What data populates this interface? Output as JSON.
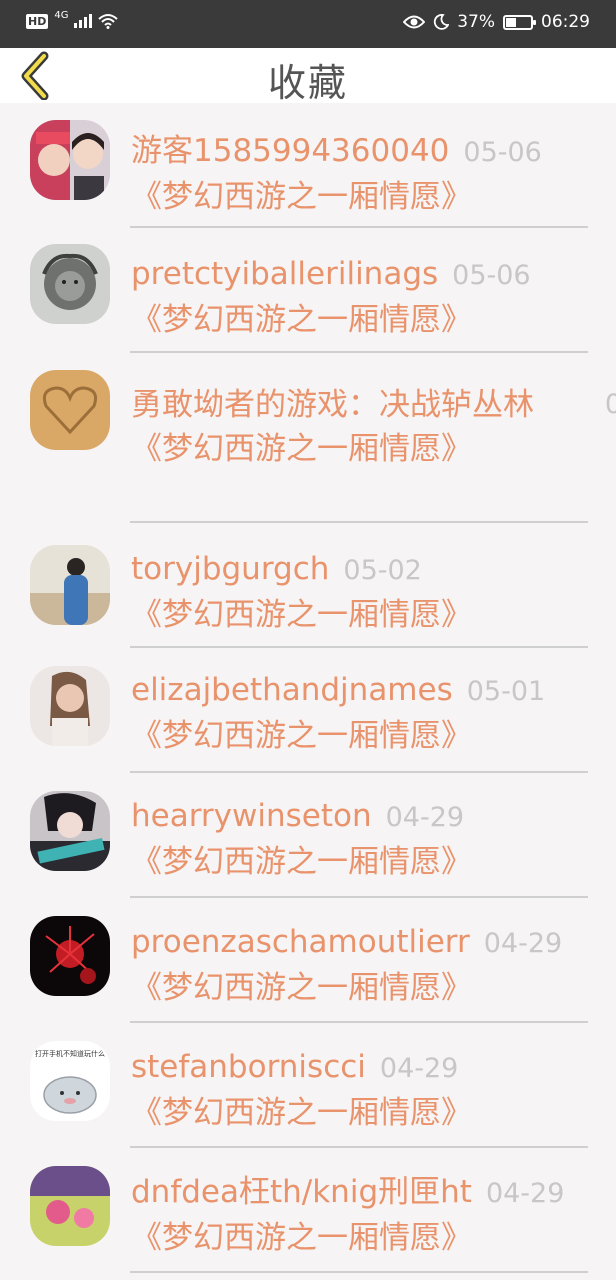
{
  "status_bar": {
    "hd": "HD",
    "network": "4G",
    "battery": "37%",
    "time": "06:29"
  },
  "nav": {
    "title": "收藏"
  },
  "items": [
    {
      "name": "游客1585994360040",
      "date": "05-06",
      "subtitle": "《梦幻西游之一厢情愿》"
    },
    {
      "name": "pretctyiballerilinags",
      "date": "05-06",
      "subtitle": "《梦幻西游之一厢情愿》"
    },
    {
      "name": "勇敢坳者的游戏：决战轳丛林",
      "date": "0",
      "subtitle": "《梦幻西游之一厢情愿》"
    },
    {
      "name": "toryjbgurgch",
      "date": "05-02",
      "subtitle": "《梦幻西游之一厢情愿》"
    },
    {
      "name": "elizajbethandjnames",
      "date": "05-01",
      "subtitle": "《梦幻西游之一厢情愿》"
    },
    {
      "name": "hearrywinseton",
      "date": "04-29",
      "subtitle": "《梦幻西游之一厢情愿》"
    },
    {
      "name": "proenzaschamoutlierr",
      "date": "04-29",
      "subtitle": "《梦幻西游之一厢情愿》"
    },
    {
      "name": "stefanborniscci",
      "date": "04-29",
      "subtitle": "《梦幻西游之一厢情愿》",
      "avatar_caption": "打开手机不知道玩什么"
    },
    {
      "name": "dnfdea枉th/knig刑匣ht",
      "date": "04-29",
      "subtitle": "《梦幻西游之一厢情愿》"
    }
  ]
}
